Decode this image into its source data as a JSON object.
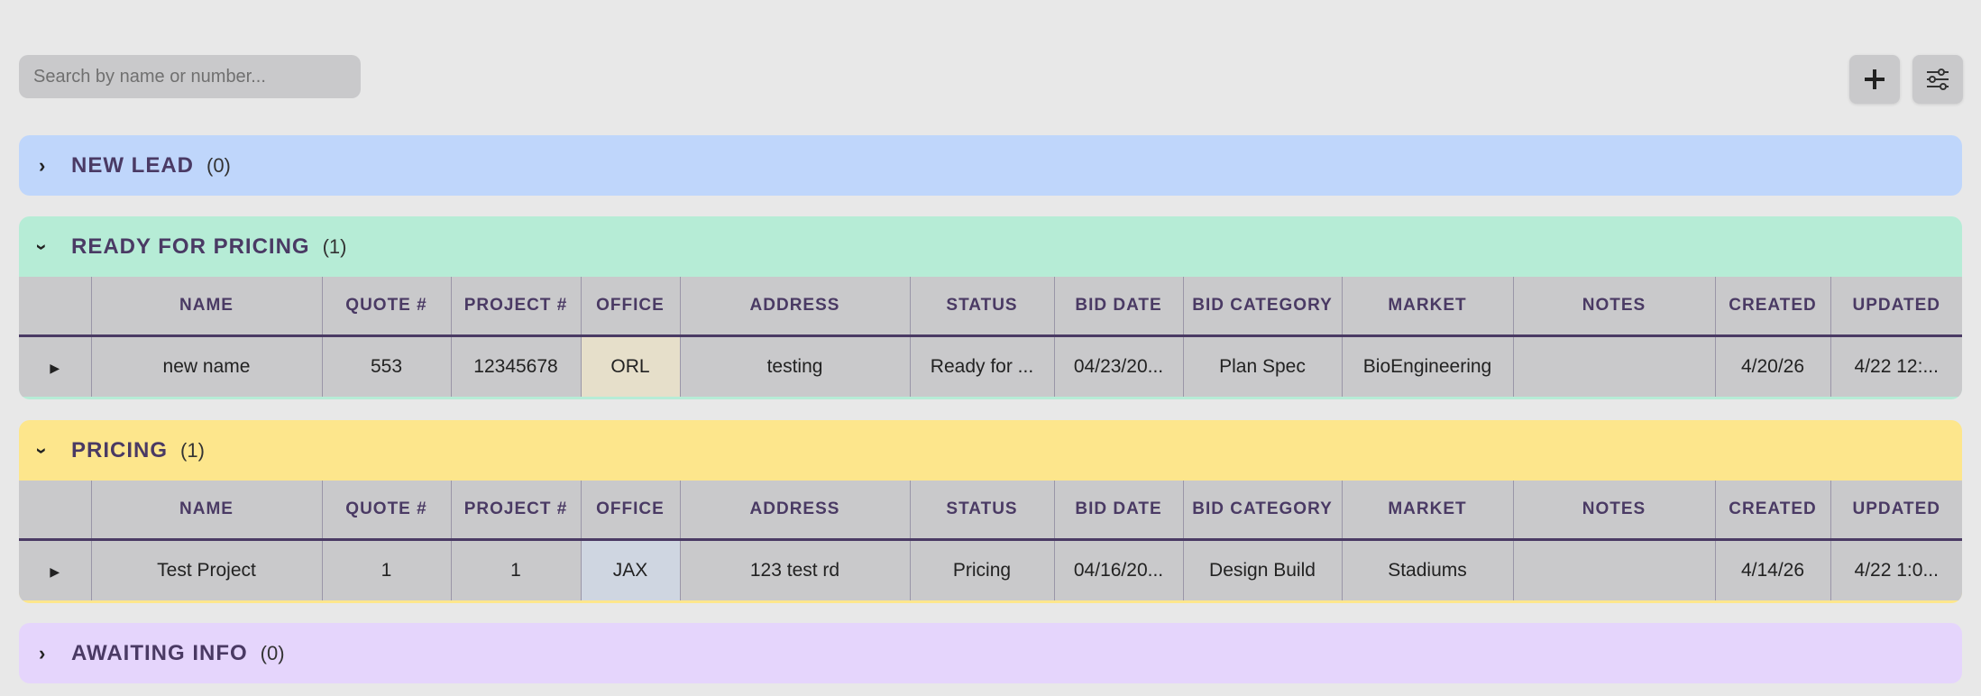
{
  "search": {
    "placeholder": "Search by name or number..."
  },
  "toolbar": {
    "add_icon": "plus-icon",
    "filter_icon": "sliders-icon"
  },
  "columns": [
    "NAME",
    "QUOTE #",
    "PROJECT #",
    "OFFICE",
    "ADDRESS",
    "STATUS",
    "BID DATE",
    "BID CATEGORY",
    "MARKET",
    "NOTES",
    "CREATED",
    "UPDATED"
  ],
  "groups": [
    {
      "title": "NEW LEAD",
      "count": "(0)",
      "color": "#bfd6fb",
      "expanded": false,
      "rows": []
    },
    {
      "title": "READY FOR PRICING",
      "count": "(1)",
      "color": "#b6ecd6",
      "expanded": true,
      "rows": [
        {
          "name": "new name",
          "quote": "553",
          "project": "12345678",
          "office": "ORL",
          "address": "testing",
          "status": "Ready for ...",
          "bid_date": "04/23/20...",
          "bid_category": "Plan Spec",
          "market": "BioEngineering",
          "notes": "",
          "created": "4/20/26",
          "updated": "4/22 12:..."
        }
      ]
    },
    {
      "title": "PRICING",
      "count": "(1)",
      "color": "#fde68c",
      "expanded": true,
      "rows": [
        {
          "name": "Test Project",
          "quote": "1",
          "project": "1",
          "office": "JAX",
          "address": "123 test rd",
          "status": "Pricing",
          "bid_date": "04/16/20...",
          "bid_category": "Design Build",
          "market": "Stadiums",
          "notes": "",
          "created": "4/14/26",
          "updated": "4/22 1:0..."
        }
      ]
    },
    {
      "title": "AWAITING INFO",
      "count": "(0)",
      "color": "#e5d5fc",
      "expanded": false,
      "rows": []
    }
  ]
}
